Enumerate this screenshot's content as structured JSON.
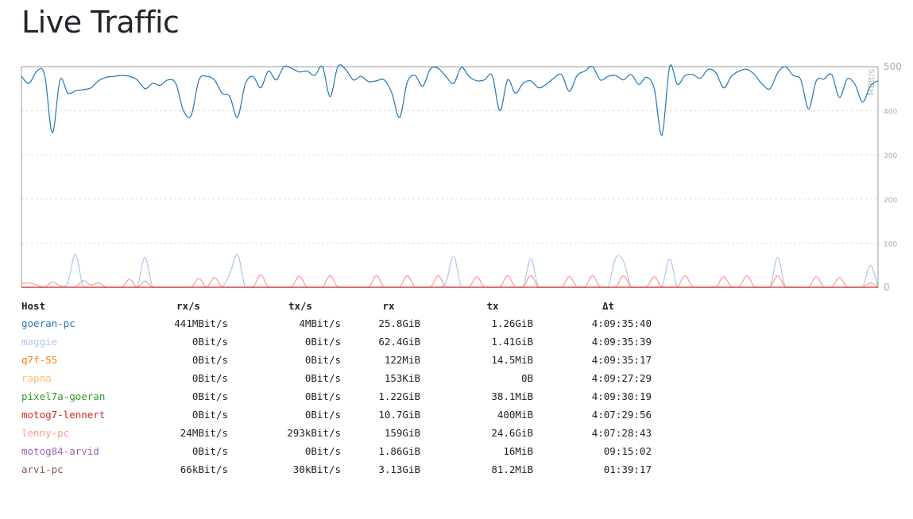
{
  "page": {
    "title": "Live Traffic"
  },
  "chart_data": {
    "type": "line",
    "ylabel": "MBit/s",
    "ylim": [
      0,
      500
    ],
    "yticks": [
      "500",
      "400",
      "300",
      "200",
      "100",
      "0"
    ],
    "grid": true,
    "series": [
      {
        "name": "goeran-pc",
        "color": "#1f77b4",
        "values": [
          478,
          462,
          490,
          482,
          350,
          470,
          440,
          445,
          448,
          452,
          468,
          476,
          478,
          480,
          478,
          470,
          450,
          462,
          458,
          470,
          462,
          400,
          390,
          470,
          478,
          470,
          440,
          432,
          385,
          460,
          478,
          452,
          490,
          470,
          500,
          496,
          488,
          490,
          480,
          500,
          432,
          500,
          494,
          470,
          478,
          466,
          468,
          470,
          440,
          385,
          465,
          480,
          456,
          495,
          496,
          478,
          462,
          498,
          478,
          468,
          470,
          480,
          400,
          470,
          440,
          462,
          468,
          452,
          460,
          474,
          482,
          444,
          480,
          490,
          500,
          470,
          478,
          480,
          470,
          482,
          460,
          476,
          450,
          345,
          500,
          460,
          480,
          482,
          474,
          494,
          486,
          452,
          478,
          490,
          494,
          482,
          460,
          450,
          486,
          500,
          480,
          470,
          404,
          468,
          472,
          482,
          430,
          472,
          460,
          420,
          456,
          468
        ]
      },
      {
        "name": "maggie",
        "color": "#aec7e8",
        "values": [
          0,
          0,
          0,
          0,
          0,
          0,
          10,
          75,
          0,
          0,
          0,
          0,
          0,
          0,
          0,
          0,
          68,
          0,
          0,
          0,
          0,
          0,
          0,
          0,
          0,
          0,
          0,
          30,
          75,
          0,
          0,
          0,
          0,
          0,
          0,
          0,
          0,
          0,
          0,
          0,
          0,
          0,
          0,
          0,
          0,
          0,
          0,
          0,
          0,
          0,
          0,
          0,
          0,
          0,
          0,
          10,
          70,
          0,
          0,
          0,
          0,
          0,
          0,
          0,
          0,
          0,
          65,
          0,
          0,
          0,
          0,
          0,
          0,
          0,
          0,
          0,
          0,
          66,
          60,
          0,
          0,
          0,
          0,
          0,
          64,
          0,
          0,
          0,
          0,
          0,
          0,
          0,
          0,
          0,
          0,
          0,
          0,
          0,
          68,
          0,
          0,
          0,
          0,
          0,
          0,
          0,
          0,
          0,
          0,
          0,
          50,
          0
        ]
      },
      {
        "name": "lenny-pc",
        "color": "#ff9896",
        "values": [
          8,
          10,
          5,
          0,
          12,
          3,
          0,
          0,
          15,
          5,
          10,
          0,
          0,
          0,
          18,
          0,
          14,
          0,
          0,
          0,
          0,
          0,
          0,
          20,
          0,
          22,
          0,
          0,
          0,
          0,
          0,
          28,
          0,
          0,
          0,
          0,
          25,
          0,
          0,
          0,
          26,
          0,
          0,
          0,
          0,
          0,
          26,
          0,
          0,
          0,
          26,
          0,
          0,
          0,
          26,
          0,
          0,
          0,
          0,
          24,
          0,
          0,
          0,
          26,
          0,
          0,
          26,
          0,
          0,
          0,
          0,
          24,
          0,
          0,
          26,
          0,
          0,
          0,
          26,
          0,
          0,
          0,
          24,
          0,
          0,
          0,
          26,
          0,
          0,
          0,
          0,
          24,
          0,
          0,
          26,
          0,
          0,
          0,
          26,
          0,
          0,
          0,
          0,
          24,
          0,
          0,
          22,
          0,
          0,
          0,
          10,
          0
        ]
      }
    ]
  },
  "table": {
    "headers": {
      "host": "Host",
      "rxs": "rx/s",
      "txs": "tx/s",
      "rx": "rx",
      "tx": "tx",
      "dt": "Δt"
    },
    "rows": [
      {
        "host": "goeran-pc",
        "color": "#1f77b4",
        "rxs": "441MBit/s",
        "txs": "4MBit/s",
        "rx": "25.8GiB",
        "tx": "1.26GiB",
        "dt": "4:09:35:40"
      },
      {
        "host": "maggie",
        "color": "#aec7e8",
        "rxs": "0Bit/s",
        "txs": "0Bit/s",
        "rx": "62.4GiB",
        "tx": "1.41GiB",
        "dt": "4:09:35:39"
      },
      {
        "host": "q7f-55",
        "color": "#ff7f0e",
        "rxs": "0Bit/s",
        "txs": "0Bit/s",
        "rx": "122MiB",
        "tx": "14.5MiB",
        "dt": "4:09:35:17"
      },
      {
        "host": "rapna",
        "color": "#ffbb78",
        "rxs": "0Bit/s",
        "txs": "0Bit/s",
        "rx": "153KiB",
        "tx": "0B",
        "dt": "4:09:27:29"
      },
      {
        "host": "pixel7a-goeran",
        "color": "#2ca02c",
        "rxs": "0Bit/s",
        "txs": "0Bit/s",
        "rx": "1.22GiB",
        "tx": "38.1MiB",
        "dt": "4:09:30:19"
      },
      {
        "host": "motog7-lennert",
        "color": "#d62728",
        "rxs": "0Bit/s",
        "txs": "0Bit/s",
        "rx": "10.7GiB",
        "tx": "400MiB",
        "dt": "4:07:29:56"
      },
      {
        "host": "lenny-pc",
        "color": "#ff9896",
        "rxs": "24MBit/s",
        "txs": "293kBit/s",
        "rx": "159GiB",
        "tx": "24.6GiB",
        "dt": "4:07:28:43"
      },
      {
        "host": "motog84-arvid",
        "color": "#9467bd",
        "rxs": "0Bit/s",
        "txs": "0Bit/s",
        "rx": "1.86GiB",
        "tx": "16MiB",
        "dt": "09:15:02"
      },
      {
        "host": "arvi-pc",
        "color": "#8c564b",
        "rxs": "66kBit/s",
        "txs": "30kBit/s",
        "rx": "3.13GiB",
        "tx": "81.2MiB",
        "dt": "01:39:17"
      }
    ]
  }
}
